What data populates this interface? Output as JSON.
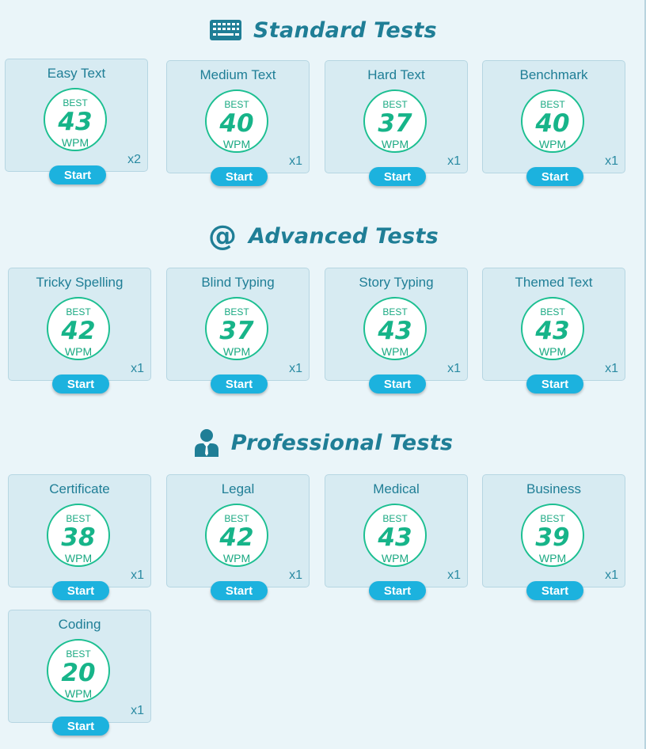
{
  "sections": [
    {
      "title": "Standard Tests",
      "icon": "keyboard-icon",
      "tests": [
        {
          "name": "Easy Text",
          "best_label": "BEST",
          "wpm": "43",
          "unit": "WPM",
          "count": "x2",
          "start": "Start"
        },
        {
          "name": "Medium Text",
          "best_label": "BEST",
          "wpm": "40",
          "unit": "WPM",
          "count": "x1",
          "start": "Start"
        },
        {
          "name": "Hard Text",
          "best_label": "BEST",
          "wpm": "37",
          "unit": "WPM",
          "count": "x1",
          "start": "Start"
        },
        {
          "name": "Benchmark",
          "best_label": "BEST",
          "wpm": "40",
          "unit": "WPM",
          "count": "x1",
          "start": "Start"
        }
      ]
    },
    {
      "title": "Advanced Tests",
      "icon": "at-sign-icon",
      "tests": [
        {
          "name": "Tricky Spelling",
          "best_label": "BEST",
          "wpm": "42",
          "unit": "WPM",
          "count": "x1",
          "start": "Start"
        },
        {
          "name": "Blind Typing",
          "best_label": "BEST",
          "wpm": "37",
          "unit": "WPM",
          "count": "x1",
          "start": "Start"
        },
        {
          "name": "Story Typing",
          "best_label": "BEST",
          "wpm": "43",
          "unit": "WPM",
          "count": "x1",
          "start": "Start"
        },
        {
          "name": "Themed Text",
          "best_label": "BEST",
          "wpm": "43",
          "unit": "WPM",
          "count": "x1",
          "start": "Start"
        }
      ]
    },
    {
      "title": "Professional Tests",
      "icon": "businessman-icon",
      "tests": [
        {
          "name": "Certificate",
          "best_label": "BEST",
          "wpm": "38",
          "unit": "WPM",
          "count": "x1",
          "start": "Start"
        },
        {
          "name": "Legal",
          "best_label": "BEST",
          "wpm": "42",
          "unit": "WPM",
          "count": "x1",
          "start": "Start"
        },
        {
          "name": "Medical",
          "best_label": "BEST",
          "wpm": "43",
          "unit": "WPM",
          "count": "x1",
          "start": "Start"
        },
        {
          "name": "Business",
          "best_label": "BEST",
          "wpm": "39",
          "unit": "WPM",
          "count": "x1",
          "start": "Start"
        },
        {
          "name": "Coding",
          "best_label": "BEST",
          "wpm": "20",
          "unit": "WPM",
          "count": "x1",
          "start": "Start"
        }
      ]
    }
  ],
  "colors": {
    "background": "#eaf5f9",
    "card": "#d7ebf2",
    "heading": "#1f7e96",
    "score": "#17b489",
    "button": "#1cb2de"
  }
}
